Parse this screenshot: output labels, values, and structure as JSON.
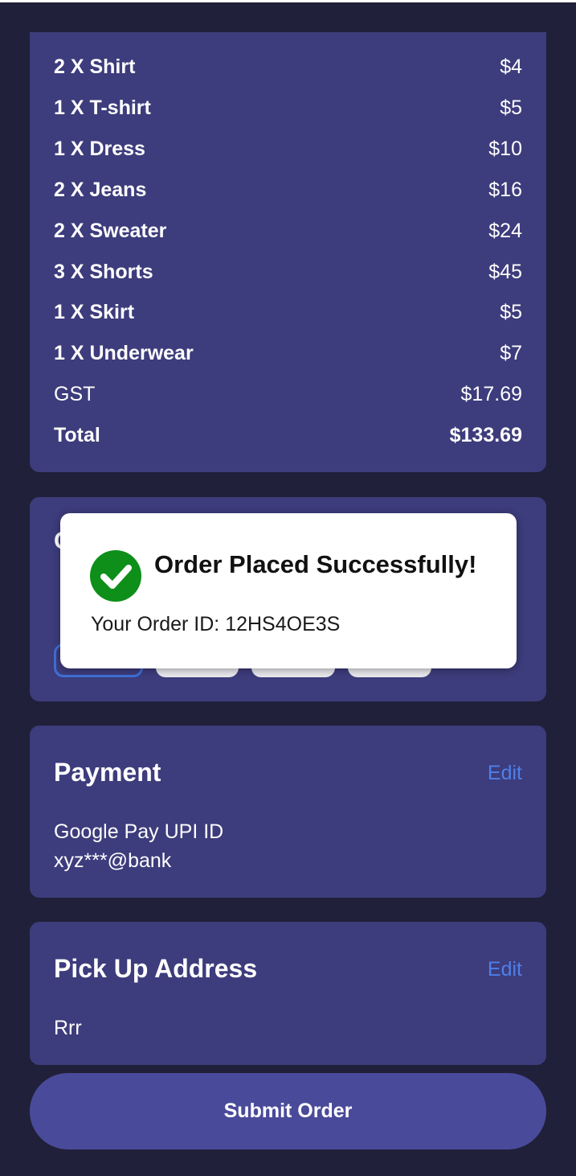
{
  "summary": {
    "items": [
      {
        "label": "2 X Shirt",
        "price": "$4"
      },
      {
        "label": "1 X T-shirt",
        "price": "$5"
      },
      {
        "label": "1 X Dress",
        "price": "$10"
      },
      {
        "label": "2 X Jeans",
        "price": "$16"
      },
      {
        "label": "2 X Sweater",
        "price": "$24"
      },
      {
        "label": "3 X Shorts",
        "price": "$45"
      },
      {
        "label": "1 X Skirt",
        "price": "$5"
      },
      {
        "label": "1 X Underwear",
        "price": "$7"
      }
    ],
    "gst_label": "GST",
    "gst_value": "$17.69",
    "total_label": "Total",
    "total_value": "$133.69"
  },
  "slots_card": {
    "title_partial": "C"
  },
  "dialog": {
    "title": "Order Placed Successfully!",
    "order_id_text": "Your Order ID: 12HS4OE3S",
    "icon": "check-circle-icon"
  },
  "payment": {
    "title": "Payment",
    "edit_label": "Edit",
    "method": "Google Pay UPI ID",
    "account": "xyz***@bank"
  },
  "address": {
    "title": "Pick Up Address",
    "edit_label": "Edit",
    "value": "Rrr"
  },
  "submit_label": "Submit Order",
  "colors": {
    "background": "#20203a",
    "card": "#3d3c7c",
    "accent": "#4f7fe8",
    "success": "#0d8f19",
    "button": "#4a4a9a"
  }
}
